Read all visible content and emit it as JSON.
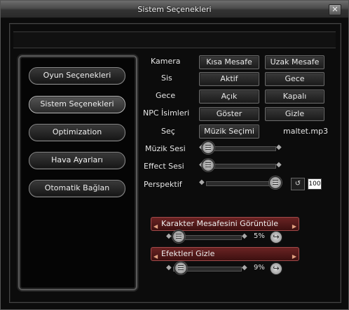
{
  "window": {
    "title": "Sistem Seçenekleri",
    "close_glyph": "✕"
  },
  "nav": [
    {
      "label": "Oyun Seçenekleri"
    },
    {
      "label": "Sistem Seçenekleri"
    },
    {
      "label": "Optimization"
    },
    {
      "label": "Hava Ayarları"
    },
    {
      "label": "Otomatik Bağlan"
    }
  ],
  "settings": {
    "kamera": {
      "label": "Kamera",
      "opt1": "Kısa Mesafe",
      "opt2": "Uzak Mesafe"
    },
    "sis": {
      "label": "Sis",
      "opt1": "Aktif",
      "opt2": "Gece"
    },
    "gece": {
      "label": "Gece",
      "opt1": "Açık",
      "opt2": "Kapalı"
    },
    "npc": {
      "label": "NPC İsimleri",
      "opt1": "Göster",
      "opt2": "Gizle"
    },
    "sec": {
      "label": "Seç",
      "button": "Müzik Seçimi",
      "file": "maltet.mp3"
    },
    "muzik_sesi": {
      "label": "Müzik Sesi",
      "level": 0.0
    },
    "effect_sesi": {
      "label": "Effect Sesi",
      "level": 0.0
    },
    "perspektif": {
      "label": "Perspektif",
      "level": 1.0,
      "undo_icon": "undo-icon",
      "value": "100"
    }
  },
  "karakter": {
    "label": "Karakter Mesafesini Görüntüle",
    "percent": "5%",
    "level": 0.05
  },
  "efekt": {
    "label": "Efektleri Gizle",
    "percent": "9%",
    "level": 0.09
  }
}
